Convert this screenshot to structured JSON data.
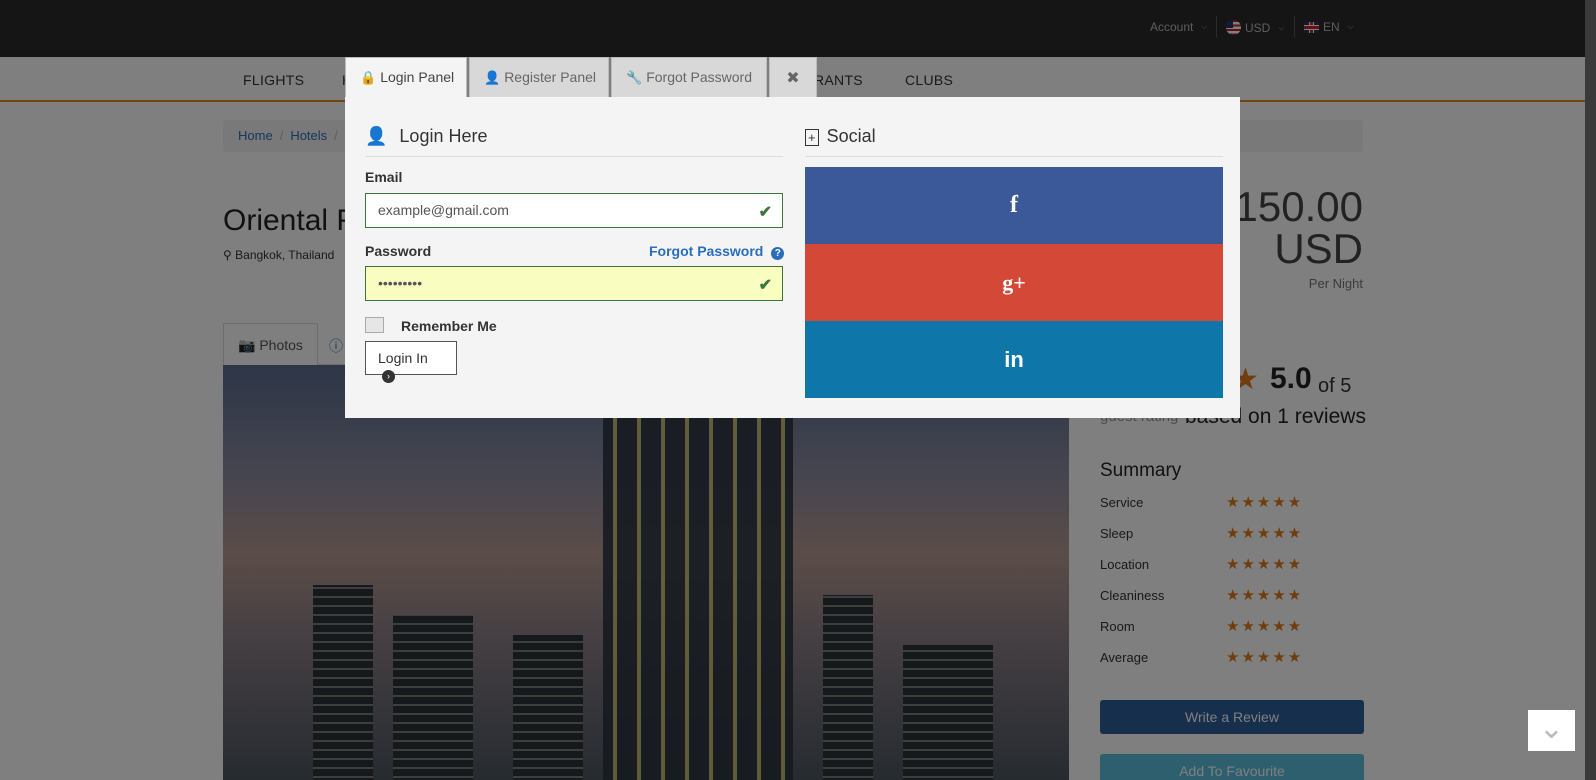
{
  "topbar": {
    "account": "Account",
    "currency": "USD",
    "language": "EN"
  },
  "nav": {
    "flights": "FLIGHTS",
    "hotels_partial": "H",
    "restaurants_partial": "RANTS",
    "clubs": "CLUBS"
  },
  "breadcrumb": {
    "home": "Home",
    "hotels": "Hotels"
  },
  "hotel": {
    "title_partial": "Oriental F",
    "location": "Bangkok, Thailand",
    "price_line1": "150.00",
    "price_line2": "USD",
    "per_night": "Per Night"
  },
  "tabs": {
    "photos": "Photos"
  },
  "rating": {
    "score": "5.0",
    "of": "of 5",
    "guest_rating": "guest rating",
    "based_on": "based on 1 reviews"
  },
  "summary": {
    "title": "Summary",
    "rows": [
      "Service",
      "Sleep",
      "Location",
      "Cleaniness",
      "Room",
      "Average"
    ],
    "stars_each": 5
  },
  "buttons": {
    "write_review": "Write a Review",
    "add_favourite": "Add To Favourite"
  },
  "modal": {
    "tabs": {
      "login": "Login Panel",
      "register": "Register Panel",
      "forgot": "Forgot Password",
      "close": "✖"
    },
    "login": {
      "heading": "Login Here",
      "email_label": "Email",
      "email_value": "example@gmail.com",
      "password_label": "Password",
      "password_value": "•••••••••",
      "forgot_link": "Forgot Password",
      "remember_me": "Remember Me",
      "login_button": "Login In"
    },
    "social": {
      "heading": "Social",
      "facebook": "f",
      "googleplus": "g+",
      "linkedin": "in"
    }
  },
  "colors": {
    "accent_orange": "#e08a1e",
    "facebook": "#3b5998",
    "googleplus": "#d34836",
    "linkedin": "#0e76a8",
    "valid_green": "#3c763d"
  }
}
